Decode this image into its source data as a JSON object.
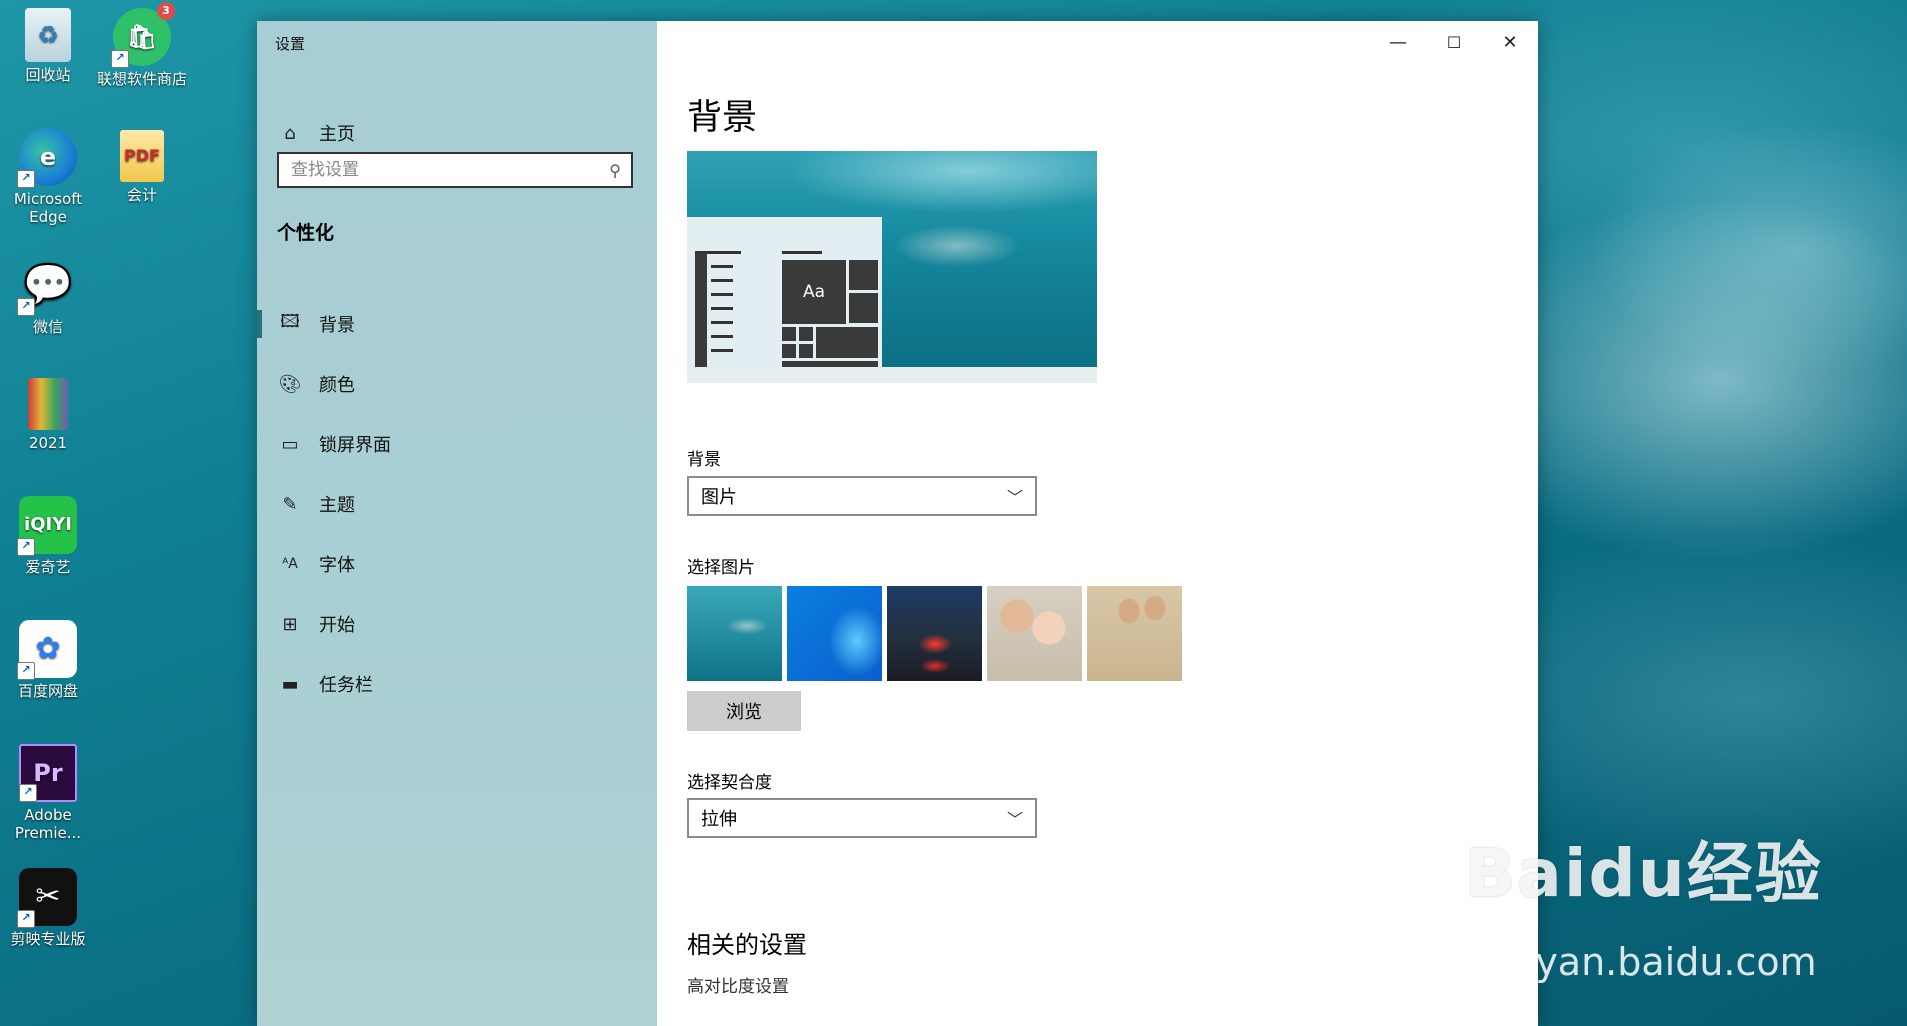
{
  "desktop": {
    "icons": [
      {
        "label": "回收站"
      },
      {
        "label": "联想软件商店",
        "badge": "3"
      },
      {
        "label": "Microsoft Edge"
      },
      {
        "label": "会计"
      },
      {
        "label": "微信"
      },
      {
        "label": "2021"
      },
      {
        "label": "爱奇艺"
      },
      {
        "label": "百度网盘"
      },
      {
        "label": "Adobe Premie..."
      },
      {
        "label": "剪映专业版"
      }
    ],
    "watermark": "Baidu经验",
    "watermark_url": "jingyan.baidu.com"
  },
  "window": {
    "title": "设置",
    "controls": {
      "minimize": "—",
      "maximize": "☐",
      "close": "✕"
    }
  },
  "sidebar": {
    "home": "主页",
    "search_placeholder": "查找设置",
    "section": "个性化",
    "items": [
      {
        "label": "背景",
        "icon": "image-icon",
        "active": true
      },
      {
        "label": "颜色",
        "icon": "palette-icon"
      },
      {
        "label": "锁屏界面",
        "icon": "lock-screen-icon"
      },
      {
        "label": "主题",
        "icon": "theme-brush-icon"
      },
      {
        "label": "字体",
        "icon": "font-icon"
      },
      {
        "label": "开始",
        "icon": "start-icon"
      },
      {
        "label": "任务栏",
        "icon": "taskbar-icon"
      }
    ]
  },
  "main": {
    "title": "背景",
    "preview_tile": "Aa",
    "background_label": "背景",
    "background_value": "图片",
    "choose_picture_label": "选择图片",
    "browse_label": "浏览",
    "fit_label": "选择契合度",
    "fit_value": "拉伸",
    "related_title": "相关的设置",
    "related_links": [
      "高对比度设置"
    ]
  },
  "colors": {
    "sidebar_bg": "#a8cfd3",
    "accent": "#2b6f7c"
  }
}
